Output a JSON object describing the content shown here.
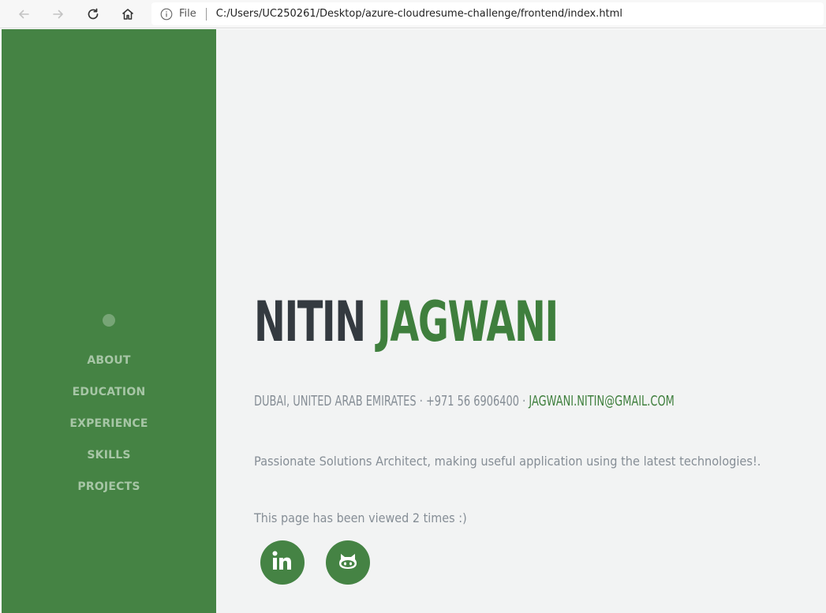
{
  "browser": {
    "file_label": "File",
    "url": "C:/Users/UC250261/Desktop/azure-cloudresume-challenge/frontend/index.html",
    "icons": [
      "back-arrow-icon",
      "forward-arrow-icon",
      "refresh-icon",
      "home-icon",
      "info-icon"
    ]
  },
  "sidebar": {
    "background": "#458344",
    "items": [
      {
        "label": "ABOUT"
      },
      {
        "label": "EDUCATION"
      },
      {
        "label": "EXPERIENCE"
      },
      {
        "label": "SKILLS"
      },
      {
        "label": "PROJECTS"
      }
    ]
  },
  "main": {
    "first_name": "NITIN",
    "last_name": "JAGWANI",
    "location": "DUBAI, UNITED ARAB EMIRATES",
    "separator": " · ",
    "phone": "+971 56 6906400",
    "email": "JAGWANI.NITIN@GMAIL.COM",
    "lead": "Passionate Solutions Architect, making useful application using the latest technologies!.",
    "counter_text": "This page has been viewed 2 times :)",
    "social": [
      {
        "icon": "linkedin-icon"
      },
      {
        "icon": "github-icon"
      }
    ]
  },
  "colors": {
    "accent": "#3f7f3d",
    "heading": "#343a40",
    "muted": "#868e96",
    "page_bg": "#f2f3f3"
  }
}
